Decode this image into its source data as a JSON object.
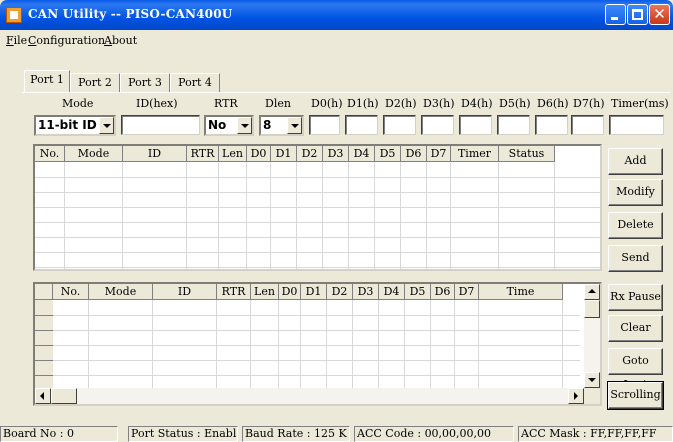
{
  "window": {
    "title": "CAN Utility -- PISO-CAN400U"
  },
  "menu": [
    "File",
    "Configuration",
    "About"
  ],
  "tabs": [
    "Port 1",
    "Port 2",
    "Port 3",
    "Port 4"
  ],
  "active_tab": "Port 1",
  "fields": {
    "mode_label": "Mode",
    "id_label": "ID(hex)",
    "rtr_label": "RTR",
    "dlen_label": "Dlen",
    "d0_label": "D0(h)",
    "d1_label": "D1(h)",
    "d2_label": "D2(h)",
    "d3_label": "D3(h)",
    "d4_label": "D4(h)",
    "d5_label": "D5(h)",
    "d6_label": "D6(h)",
    "d7_label": "D7(h)",
    "timer_label": "Timer(ms)",
    "mode_value": "11-bit ID",
    "rtr_value": "No",
    "dlen_value": "8"
  },
  "send_table": {
    "columns": [
      "No.",
      "Mode",
      "ID",
      "RTR",
      "Len",
      "D0",
      "D1",
      "D2",
      "D3",
      "D4",
      "D5",
      "D6",
      "D7",
      "Timer",
      "Status"
    ]
  },
  "receive_table": {
    "columns": [
      "No.",
      "Mode",
      "ID",
      "RTR",
      "Len",
      "D0",
      "D1",
      "D2",
      "D3",
      "D4",
      "D5",
      "D6",
      "D7",
      "Time Stamps(s)"
    ]
  },
  "buttons": {
    "add": "Add",
    "modify": "Modify",
    "delete": "Delete",
    "send": "Send",
    "rx_pause": "Rx Pause",
    "clear": "Clear",
    "goto_last": "Goto Last",
    "scrolling": "Scrolling"
  },
  "status": {
    "board": "Board No : 0",
    "port_status": "Port Status : Enable",
    "baud": "Baud Rate : 125 K",
    "acc_code": "ACC Code : 00,00,00,00",
    "acc_mask": "ACC Mask : FF,FF,FF,FF"
  }
}
